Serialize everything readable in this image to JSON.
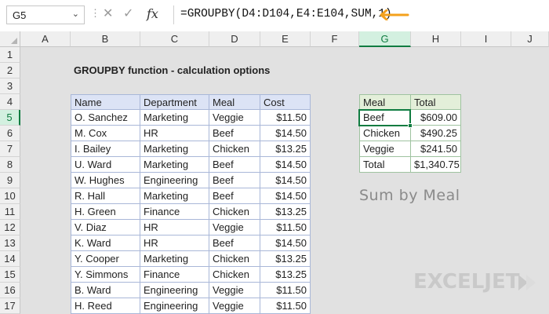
{
  "name_box": "G5",
  "formula": "=GROUPBY(D4:D104,E4:E104,SUM,1)",
  "fx_label": "fx",
  "columns": [
    "A",
    "B",
    "C",
    "D",
    "E",
    "F",
    "G",
    "H",
    "I",
    "J"
  ],
  "rows": [
    "1",
    "2",
    "3",
    "4",
    "5",
    "6",
    "7",
    "8",
    "9",
    "10",
    "11",
    "12",
    "13",
    "14",
    "15",
    "16",
    "17"
  ],
  "title": "GROUPBY function - calculation options",
  "table": {
    "headers": [
      "Name",
      "Department",
      "Meal",
      "Cost"
    ],
    "rows": [
      [
        "O. Sanchez",
        "Marketing",
        "Veggie",
        "$11.50"
      ],
      [
        "M. Cox",
        "HR",
        "Beef",
        "$14.50"
      ],
      [
        "I. Bailey",
        "Marketing",
        "Chicken",
        "$13.25"
      ],
      [
        "U. Ward",
        "Marketing",
        "Beef",
        "$14.50"
      ],
      [
        "W. Hughes",
        "Engineering",
        "Beef",
        "$14.50"
      ],
      [
        "R. Hall",
        "Marketing",
        "Beef",
        "$14.50"
      ],
      [
        "H. Green",
        "Finance",
        "Chicken",
        "$13.25"
      ],
      [
        "V. Diaz",
        "HR",
        "Veggie",
        "$11.50"
      ],
      [
        "K. Ward",
        "HR",
        "Beef",
        "$14.50"
      ],
      [
        "Y. Cooper",
        "Marketing",
        "Chicken",
        "$13.25"
      ],
      [
        "Y. Simmons",
        "Finance",
        "Chicken",
        "$13.25"
      ],
      [
        "B. Ward",
        "Engineering",
        "Veggie",
        "$11.50"
      ],
      [
        "H. Reed",
        "Engineering",
        "Veggie",
        "$11.50"
      ]
    ]
  },
  "result": {
    "headers": [
      "Meal",
      "Total"
    ],
    "rows": [
      [
        "Beef",
        "$609.00"
      ],
      [
        "Chicken",
        "$490.25"
      ],
      [
        "Veggie",
        "$241.50"
      ],
      [
        "Total",
        "$1,340.75"
      ]
    ]
  },
  "annotation": "Sum by Meal",
  "logo": "EXCELJET",
  "colors": {
    "accent": "#107c41",
    "table_header": "#dce3f5",
    "result_header": "#e3efd9",
    "arrow": "#f4a11c"
  }
}
